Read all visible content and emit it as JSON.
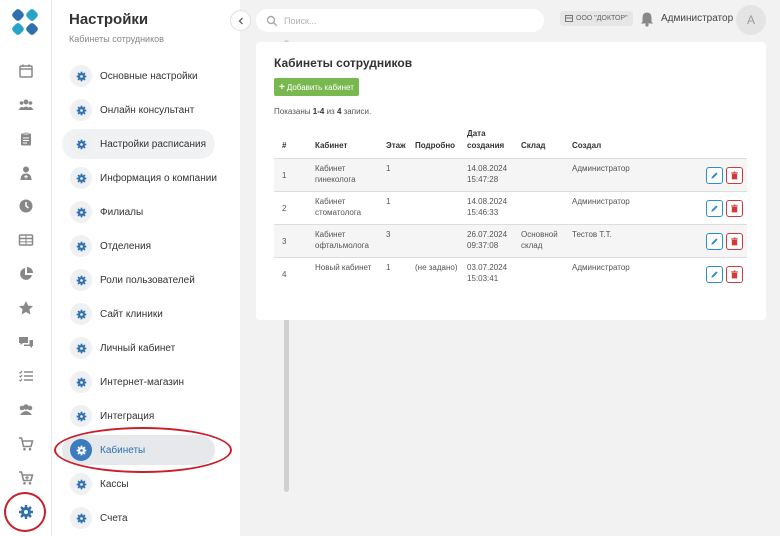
{
  "rail": {
    "icons": [
      "calendar-icon",
      "users-icon",
      "clipboard-icon",
      "doctor-icon",
      "clock-icon",
      "table-icon",
      "pie-chart-icon",
      "star-icon",
      "chat-icon",
      "list-icon",
      "groups-icon",
      "cart-icon",
      "cart-plus-icon",
      "gear-icon"
    ]
  },
  "menu": {
    "title": "Настройки",
    "subtitle": "Кабинеты сотрудников",
    "items": [
      {
        "label": "Основные настройки"
      },
      {
        "label": "Онлайн консультант"
      },
      {
        "label": "Настройки расписания"
      },
      {
        "label": "Информация о компании"
      },
      {
        "label": "Филиалы"
      },
      {
        "label": "Отделения"
      },
      {
        "label": "Роли пользователей"
      },
      {
        "label": "Сайт клиники"
      },
      {
        "label": "Личный кабинет"
      },
      {
        "label": "Интернет-магазин"
      },
      {
        "label": "Интеграция"
      },
      {
        "label": "Кабинеты"
      },
      {
        "label": "Кассы"
      },
      {
        "label": "Счета"
      }
    ],
    "active_index": 11,
    "hover_index": 2
  },
  "topbar": {
    "search_placeholder": "Поиск...",
    "org": "ООО \"ДОКТОР\"",
    "user": "Администратор",
    "avatar_letter": "A"
  },
  "page": {
    "title": "Кабинеты сотрудников",
    "add_button": "Добавить кабинет",
    "shown_prefix": "Показаны",
    "shown_range": "1-4",
    "shown_of": "из",
    "shown_total": "4",
    "shown_suffix": "записи."
  },
  "table": {
    "headers": {
      "num": "#",
      "name": "Кабинет",
      "floor": "Этаж",
      "details": "Подробно",
      "created": "Дата создания",
      "warehouse": "Склад",
      "author": "Создал"
    },
    "rows": [
      {
        "num": "1",
        "name": "Кабинет гинеколога",
        "floor": "1",
        "details": "",
        "created": "14.08.2024 15:47:28",
        "warehouse": "",
        "author": "Администратор"
      },
      {
        "num": "2",
        "name": "Кабинет стоматолога",
        "floor": "1",
        "details": "",
        "created": "14.08.2024 15:46:33",
        "warehouse": "",
        "author": "Администратор"
      },
      {
        "num": "3",
        "name": "Кабинет офтальмолога",
        "floor": "3",
        "details": "",
        "created": "26.07.2024 09:37:08",
        "warehouse": "Основной склад",
        "author": "Тестов Т.Т."
      },
      {
        "num": "4",
        "name": "Новый кабинет",
        "floor": "1",
        "details": "(не задано)",
        "created": "03.07.2024 15:03:41",
        "warehouse": "",
        "author": "Администратор"
      }
    ]
  },
  "colors": {
    "accent": "#3b7bbf",
    "add_green": "#78b84f",
    "edit_blue": "#2b8fc9",
    "delete_red": "#d03a3a",
    "annotation_red": "#c8202b"
  }
}
